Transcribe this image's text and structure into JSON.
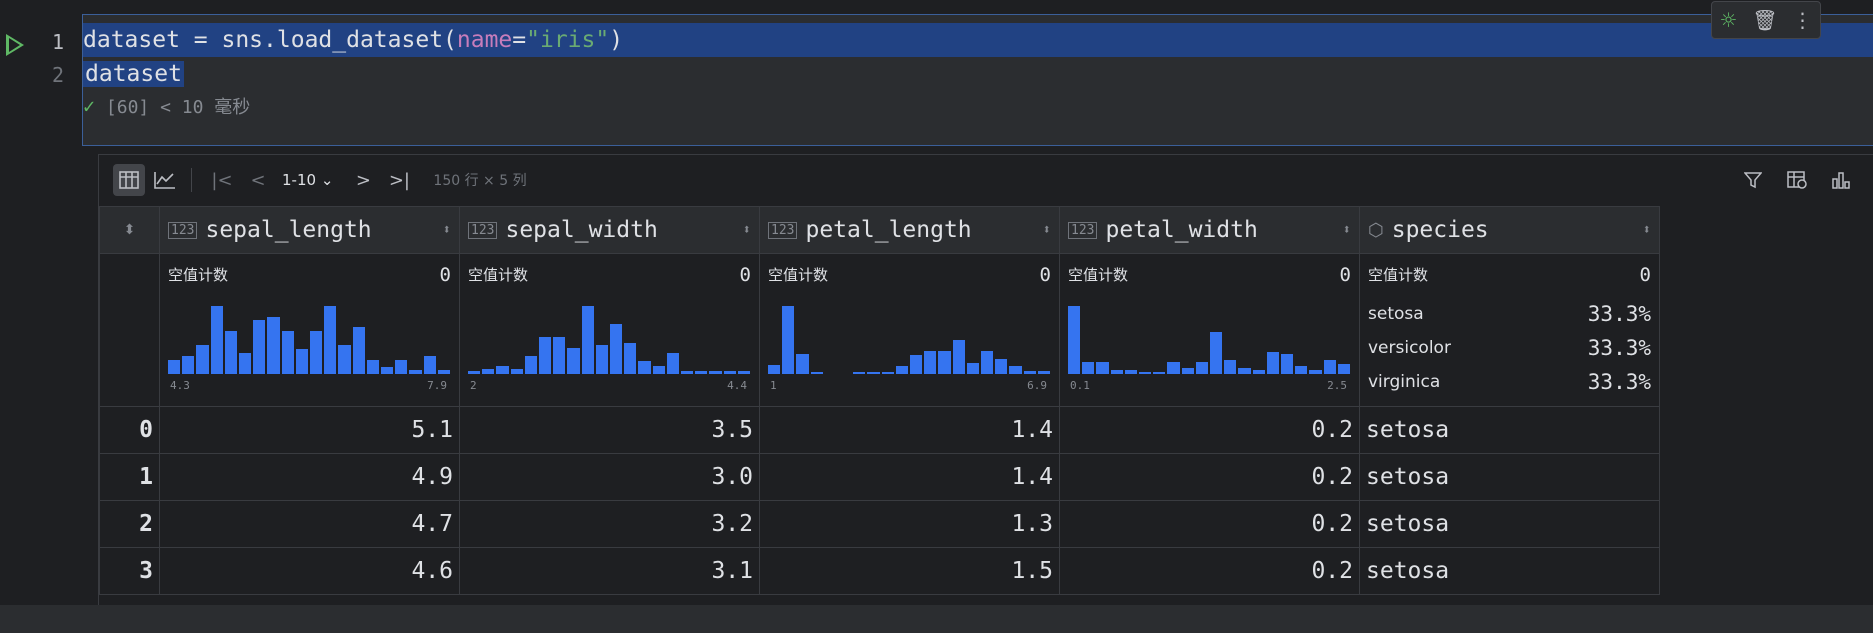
{
  "editor": {
    "line_numbers": [
      "1",
      "2"
    ],
    "line1": {
      "var": "dataset",
      "op": " = ",
      "call": "sns.load_dataset(",
      "param": "name",
      "eq": "=",
      "str": "\"iris\"",
      "close": ")"
    },
    "line2": "dataset",
    "exec_status": "[60] < 10 毫秒"
  },
  "cell_toolbar": {
    "icons": [
      "debug-icon",
      "trash-icon",
      "more-vert-icon"
    ]
  },
  "toolbar": {
    "page_range": "1-10",
    "summary": "150 行 × 5 列"
  },
  "table": {
    "columns": [
      {
        "name": "sepal_length",
        "type": "123"
      },
      {
        "name": "sepal_width",
        "type": "123"
      },
      {
        "name": "petal_length",
        "type": "123"
      },
      {
        "name": "petal_width",
        "type": "123"
      },
      {
        "name": "species",
        "type": "cube"
      }
    ],
    "null_label": "空值计数",
    "null_counts": [
      "0",
      "0",
      "0",
      "0",
      "0"
    ],
    "histograms": [
      {
        "min": "4.3",
        "max": "7.9",
        "bins": [
          4,
          5,
          8,
          19,
          12,
          6,
          15,
          16,
          12,
          7,
          12,
          19,
          8,
          13,
          4,
          2,
          4,
          1,
          5,
          1
        ]
      },
      {
        "min": "2",
        "max": "4.4",
        "bins": [
          1,
          2,
          3,
          2,
          7,
          14,
          14,
          10,
          26,
          11,
          19,
          12,
          5,
          3,
          8,
          1,
          1,
          1,
          1,
          1
        ]
      },
      {
        "min": "1",
        "max": "6.9",
        "bins": [
          6,
          44,
          13,
          1,
          0,
          0,
          1,
          1,
          1,
          5,
          12,
          15,
          15,
          22,
          7,
          15,
          10,
          5,
          2,
          2
        ]
      },
      {
        "min": "0.1",
        "max": "2.5",
        "bins": [
          34,
          6,
          6,
          2,
          2,
          1,
          1,
          6,
          3,
          6,
          21,
          7,
          3,
          2,
          11,
          10,
          4,
          2,
          7,
          5
        ]
      }
    ],
    "categories": [
      {
        "name": "setosa",
        "pct": "33.3%"
      },
      {
        "name": "versicolor",
        "pct": "33.3%"
      },
      {
        "name": "virginica",
        "pct": "33.3%"
      }
    ],
    "rows": [
      {
        "idx": "0",
        "v": [
          "5.1",
          "3.5",
          "1.4",
          "0.2",
          "setosa"
        ]
      },
      {
        "idx": "1",
        "v": [
          "4.9",
          "3.0",
          "1.4",
          "0.2",
          "setosa"
        ]
      },
      {
        "idx": "2",
        "v": [
          "4.7",
          "3.2",
          "1.3",
          "0.2",
          "setosa"
        ]
      },
      {
        "idx": "3",
        "v": [
          "4.6",
          "3.1",
          "1.5",
          "0.2",
          "setosa"
        ]
      }
    ]
  },
  "colors": {
    "accent": "#3574f0",
    "run": "#5fb865",
    "selection": "#214283"
  }
}
